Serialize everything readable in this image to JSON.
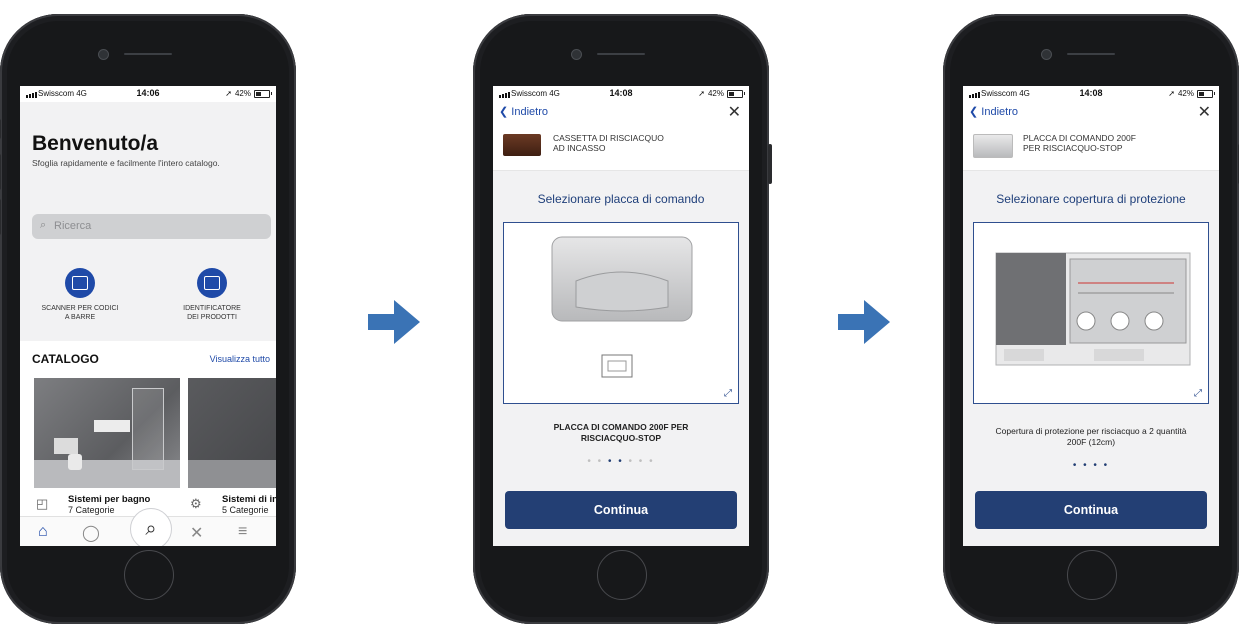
{
  "colors": {
    "accent": "#1f4aa8",
    "button": "#233f74",
    "arrow": "#3a73b5"
  },
  "screen1": {
    "status": {
      "carrier": "Swisscom 4G",
      "time": "14:06",
      "battery": "42%"
    },
    "title": "Benvenuto/a",
    "subtitle": "Sfoglia rapidamente e facilmente l'intero catalogo.",
    "search_placeholder": "Ricerca",
    "features": [
      {
        "line1": "SCANNER PER CODICI",
        "line2": "A BARRE",
        "icon": "barcode-icon"
      },
      {
        "line1": "IDENTIFICATORE",
        "line2": "DEI PRODOTTI",
        "icon": "camera-identify-icon"
      }
    ],
    "catalog_title": "CATALOGO",
    "catalog_link": "Visualizza tutto",
    "cards": [
      {
        "title": "Sistemi per bagno",
        "subtitle": "7 Categorie"
      },
      {
        "title": "Sistemi di ins",
        "subtitle": "5 Categorie"
      }
    ],
    "tabs": [
      "home-icon",
      "user-icon",
      "search-icon",
      "tools-icon",
      "menu-icon"
    ]
  },
  "screen2": {
    "status": {
      "carrier": "Swisscom 4G",
      "time": "14:08",
      "battery": "42%"
    },
    "back_label": "Indietro",
    "product_line1": "CASSETTA DI RISCIACQUO",
    "product_line2": "AD INCASSO",
    "section_title": "Selezionare placca di comando",
    "caption_line1": "PLACCA DI COMANDO 200F PER",
    "caption_line2": "RISCIACQUO-STOP",
    "button_label": "Continua"
  },
  "screen3": {
    "status": {
      "carrier": "Swisscom 4G",
      "time": "14:08",
      "battery": "42%"
    },
    "back_label": "Indietro",
    "product_line1": "PLACCA DI COMANDO 200F",
    "product_line2": "PER RISCIACQUO-STOP",
    "section_title": "Selezionare copertura di protezione",
    "caption_line1": "Copertura di protezione per risciacquo a 2 quantità",
    "caption_line2": "200F (12cm)",
    "button_label": "Continua"
  }
}
